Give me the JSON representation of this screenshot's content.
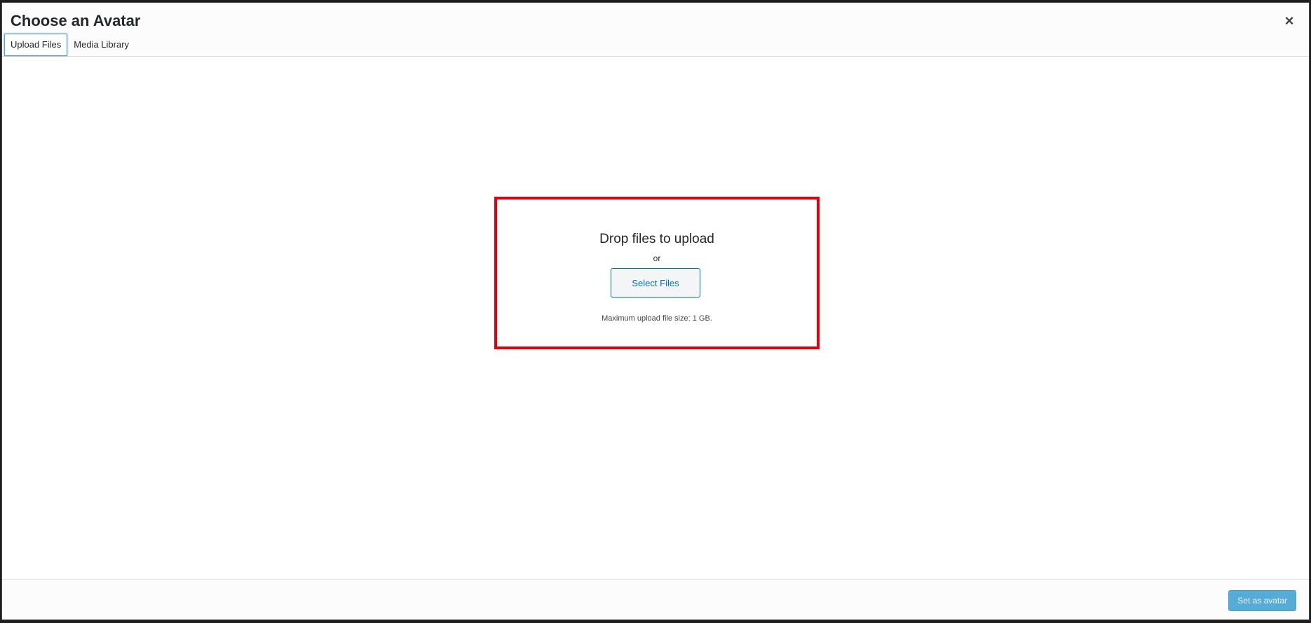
{
  "modal": {
    "title": "Choose an Avatar",
    "close_glyph": "×"
  },
  "tabs": [
    {
      "label": "Upload Files",
      "active": true
    },
    {
      "label": "Media Library",
      "active": false
    }
  ],
  "uploader": {
    "drop_text": "Drop files to upload",
    "or_text": "or",
    "select_button": "Select Files",
    "max_size_text": "Maximum upload file size: 1 GB."
  },
  "footer": {
    "primary_button": "Set as avatar"
  },
  "colors": {
    "highlight_border": "#e2000e",
    "primary_button": "#3a9fd0",
    "link_blue": "#0073aa"
  }
}
